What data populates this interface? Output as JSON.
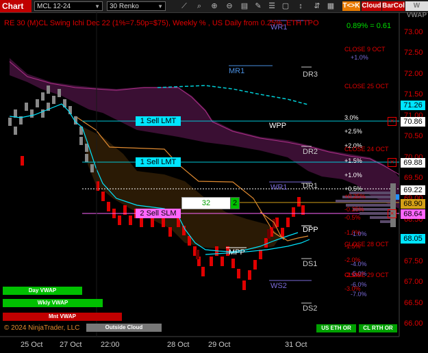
{
  "toolbar": {
    "chart_label": "Chart",
    "instrument": "MCL 12-24",
    "bar_type": "30 Renko",
    "toggle_tck": "T<>K",
    "toggle_cloud": "Cloud",
    "toggle_barcol": "BarCol",
    "toggle_vwap": "W VWAP",
    "icons": [
      "line-tool-icon",
      "magnify-icon",
      "zoom-in-icon",
      "zoom-out-icon",
      "properties-icon",
      "draw-icon",
      "list-icon",
      "box-icon",
      "arrow-icon",
      "chart-trader-icon"
    ]
  },
  "header": {
    "title": "RE 30 (M)CL Swing Ichi Dec 22  (1%=7.50p=$75), Weekly % , US Daily from 0.25%, ETH TPO",
    "top_right": "0.89% = 0.61"
  },
  "price_axis": {
    "ticks": [
      "73.00",
      "72.50",
      "72.00",
      "71.50",
      "71.00",
      "70.50",
      "70.00",
      "69.50",
      "69.00",
      "68.50",
      "68.00",
      "67.50",
      "67.00",
      "66.50",
      "66.00"
    ],
    "tags": [
      {
        "label": "71.26",
        "color": "#00e5ff",
        "text_color": "#000"
      },
      {
        "label": "70.86",
        "color": "#ffffff",
        "text_color": "#000"
      },
      {
        "label": "69.88",
        "color": "#ffffff",
        "text_color": "#000"
      },
      {
        "label": "69.22",
        "color": "#ffffff",
        "text_color": "#000"
      },
      {
        "label": "68.90",
        "color": "#d4a017",
        "text_color": "#000"
      },
      {
        "label": "68.64",
        "color": "#ff66ff",
        "text_color": "#000"
      },
      {
        "label": "68.05",
        "color": "#00e5ff",
        "text_color": "#000"
      }
    ]
  },
  "time_axis": [
    "25 Oct",
    "27 Oct",
    "22:00",
    "28 Oct",
    "29 Oct",
    "31 Oct"
  ],
  "orders": [
    {
      "label": "1 Sell LMT",
      "price": 70.86
    },
    {
      "label": "1 Sell LMT",
      "price": 69.88
    },
    {
      "label": "2 Sell SLM",
      "price": 68.64
    }
  ],
  "order_entry": {
    "qty": "32",
    "count": "2"
  },
  "pivot_labels": [
    "WR1",
    "MR1",
    "DR3",
    "WPP",
    "DR2",
    "WR1",
    "DR1",
    "DPP",
    "MPP",
    "DS1",
    "WS2",
    "DS2"
  ],
  "pct_levels": [
    "3.0%",
    "+2.5%",
    "+2.0%",
    "+1.5%",
    "+1.0%",
    "+0.5%",
    "+0.25%",
    "-0.25%",
    "-0.5%",
    "-1.0%",
    "-1.5%",
    "-2.0%",
    "-2.5%",
    "-3.0%"
  ],
  "weekly_pct": [
    "+1.0%",
    "-1.0%",
    "-4.0%",
    "-5.0%",
    "-6.0%",
    "-7.0%"
  ],
  "close_labels": [
    "CLOSE 9 OCT",
    "CLOSE 25 OCT",
    "CLOSE 24 OCT",
    "CLOSE 28 OCT",
    "CLOSE 29 OCT"
  ],
  "buttons": {
    "day_vwap": "Day VWAP",
    "wkly_vwap": "Wkly VWAP",
    "mnt_vwap": "Mnt VWAP",
    "outside_cloud": "Outside Cloud",
    "us_eth_or": "US ETH OR",
    "cl_rth_or": "CL RTH OR"
  },
  "copyright": "© 2024 NinjaTrader, LLC",
  "chart_data": {
    "type": "line",
    "title": "",
    "x": [
      "25 Oct",
      "27 Oct",
      "22:00",
      "28 Oct",
      "29 Oct",
      "31 Oct"
    ],
    "ylim": [
      66.0,
      73.0
    ],
    "series": [
      {
        "name": "",
        "values": [
          70.5,
          71.5,
          70.5,
          69.0,
          68.0,
          67.3,
          67.8,
          68.6,
          69.2,
          68.9
        ]
      }
    ]
  }
}
